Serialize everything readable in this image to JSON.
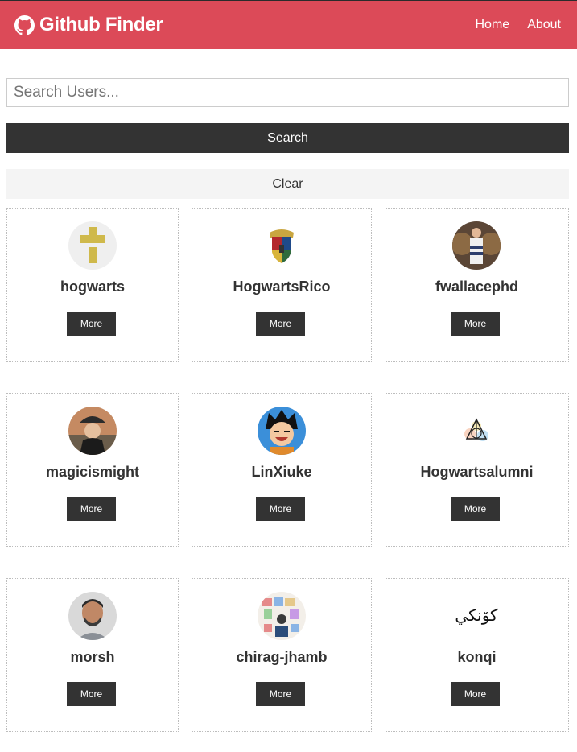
{
  "navbar": {
    "brand_icon": "github-icon",
    "title": "Github Finder",
    "links": [
      "Home",
      "About"
    ],
    "background_color": "#dc4a58"
  },
  "search": {
    "placeholder": "Search Users...",
    "value": "",
    "search_label": "Search",
    "clear_label": "Clear"
  },
  "users": [
    {
      "login": "hogwarts",
      "avatar": "yellow-identicon",
      "more_label": "More"
    },
    {
      "login": "HogwartsRico",
      "avatar": "hogwarts-crest",
      "more_label": "More"
    },
    {
      "login": "fwallacephd",
      "avatar": "person-photo",
      "more_label": "More"
    },
    {
      "login": "magicismight",
      "avatar": "person-photo",
      "more_label": "More"
    },
    {
      "login": "LinXiuke",
      "avatar": "cartoon-character",
      "more_label": "More"
    },
    {
      "login": "Hogwartsalumni",
      "avatar": "deathly-hallows-symbol",
      "more_label": "More"
    },
    {
      "login": "morsh",
      "avatar": "person-photo",
      "more_label": "More"
    },
    {
      "login": "chirag-jhamb",
      "avatar": "collage-photo",
      "more_label": "More"
    },
    {
      "login": "konqi",
      "avatar": "arabic-text-logo",
      "avatar_text": "كۆنكي",
      "more_label": "More"
    }
  ]
}
